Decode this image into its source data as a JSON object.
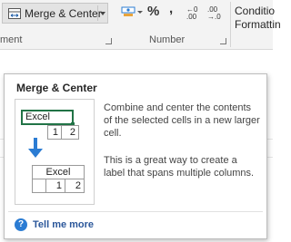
{
  "ribbon": {
    "merge_center_label": "Merge & Center",
    "percent_symbol": "%",
    "comma_symbol": ",",
    "increase_decimal_text": "←0\n.00",
    "decrease_decimal_text": ".00\n→.0",
    "conditional_formatting_label": "Conditio\nFormattin",
    "group_alignment_label": "ment",
    "group_number_label": "Number",
    "accent_color": "#217346"
  },
  "tooltip": {
    "title": "Merge & Center",
    "description": "Combine and center the contents of the selected cells in a new larger cell.",
    "example": "This is a great way to create a label that spans multiple columns.",
    "illustration": {
      "before_cell": "Excel",
      "before_numbers": [
        "1",
        "2"
      ],
      "after_cell": "Excel",
      "after_numbers": [
        "1",
        "2"
      ]
    },
    "help_link": "Tell me more",
    "help_icon_glyph": "?",
    "link_color": "#2b579a"
  }
}
